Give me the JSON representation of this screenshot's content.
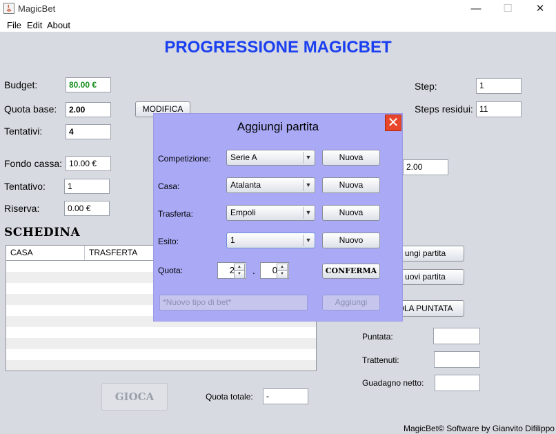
{
  "window": {
    "title": "MagicBet",
    "controls": [
      "—",
      "☐",
      "✕"
    ]
  },
  "menu": [
    "File",
    "Edit",
    "About"
  ],
  "main_title": "PROGRESSIONE MAGICBET",
  "left": {
    "budget_label": "Budget:",
    "budget_value": "80.00 €",
    "quota_base_label": "Quota base:",
    "quota_base_value": "2.00",
    "modifica_label": "MODIFICA",
    "tentativi_label": "Tentativi:",
    "tentativi_value": "4",
    "fondo_cassa_label": "Fondo cassa:",
    "fondo_cassa_value": "10.00 €",
    "tentativo_label": "Tentativo:",
    "tentativo_value": "1",
    "riserva_label": "Riserva:",
    "riserva_value": "0.00 €"
  },
  "right": {
    "step_label": "Step:",
    "step_value": "1",
    "steps_residui_label": "Steps residui:",
    "steps_residui_value": "11",
    "hidden_field_value": "2.00",
    "aggiungi_partita_btn": "ungi partita",
    "nuovi_partita_btn": "uovi partita",
    "calcola_puntata_btn": "OLA PUNTATA",
    "puntata_label": "Puntata:",
    "trattenuti_label": "Trattenuti:",
    "guadagno_label": "Guadagno netto:"
  },
  "schedina": {
    "title": "SCHEDINA",
    "columns": [
      "CASA",
      "TRASFERTA"
    ]
  },
  "gioca_label": "GIOCA",
  "quota_totale_label": "Quota totale:",
  "quota_totale_value": "-",
  "footer": "MagicBet© Software by Gianvito Difilippo",
  "dialog": {
    "title": "Aggiungi partita",
    "close": "✕",
    "competizione_label": "Competizione:",
    "competizione_value": "Serie A",
    "casa_label": "Casa:",
    "casa_value": "Atalanta",
    "trasferta_label": "Trasferta:",
    "trasferta_value": "Empoli",
    "esito_label": "Esito:",
    "esito_value": "1",
    "nuova_label": "Nuova",
    "nuovo_label": "Nuovo",
    "quota_label": "Quota:",
    "quota_int": "2",
    "quota_sep": ".",
    "quota_dec": "0",
    "conferma_label": "CONFERMA",
    "bet_placeholder": "*Nuovo tipo di bet*",
    "aggiungi_label": "Aggiungi"
  },
  "colors": {
    "title_blue": "#1a3ff0",
    "budget_green": "#17901f",
    "dialog_bg": "#a9a9f6",
    "close_red": "#e8462a"
  }
}
